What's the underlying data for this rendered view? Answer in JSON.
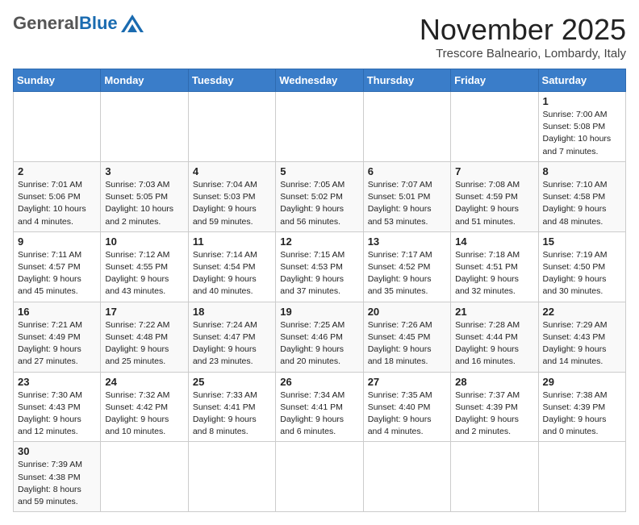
{
  "header": {
    "logo_general": "General",
    "logo_blue": "Blue",
    "month_title": "November 2025",
    "location": "Trescore Balneario, Lombardy, Italy"
  },
  "days_of_week": [
    "Sunday",
    "Monday",
    "Tuesday",
    "Wednesday",
    "Thursday",
    "Friday",
    "Saturday"
  ],
  "weeks": [
    [
      {
        "day": "",
        "info": ""
      },
      {
        "day": "",
        "info": ""
      },
      {
        "day": "",
        "info": ""
      },
      {
        "day": "",
        "info": ""
      },
      {
        "day": "",
        "info": ""
      },
      {
        "day": "",
        "info": ""
      },
      {
        "day": "1",
        "info": "Sunrise: 7:00 AM\nSunset: 5:08 PM\nDaylight: 10 hours\nand 7 minutes."
      }
    ],
    [
      {
        "day": "2",
        "info": "Sunrise: 7:01 AM\nSunset: 5:06 PM\nDaylight: 10 hours\nand 4 minutes."
      },
      {
        "day": "3",
        "info": "Sunrise: 7:03 AM\nSunset: 5:05 PM\nDaylight: 10 hours\nand 2 minutes."
      },
      {
        "day": "4",
        "info": "Sunrise: 7:04 AM\nSunset: 5:03 PM\nDaylight: 9 hours\nand 59 minutes."
      },
      {
        "day": "5",
        "info": "Sunrise: 7:05 AM\nSunset: 5:02 PM\nDaylight: 9 hours\nand 56 minutes."
      },
      {
        "day": "6",
        "info": "Sunrise: 7:07 AM\nSunset: 5:01 PM\nDaylight: 9 hours\nand 53 minutes."
      },
      {
        "day": "7",
        "info": "Sunrise: 7:08 AM\nSunset: 4:59 PM\nDaylight: 9 hours\nand 51 minutes."
      },
      {
        "day": "8",
        "info": "Sunrise: 7:10 AM\nSunset: 4:58 PM\nDaylight: 9 hours\nand 48 minutes."
      }
    ],
    [
      {
        "day": "9",
        "info": "Sunrise: 7:11 AM\nSunset: 4:57 PM\nDaylight: 9 hours\nand 45 minutes."
      },
      {
        "day": "10",
        "info": "Sunrise: 7:12 AM\nSunset: 4:55 PM\nDaylight: 9 hours\nand 43 minutes."
      },
      {
        "day": "11",
        "info": "Sunrise: 7:14 AM\nSunset: 4:54 PM\nDaylight: 9 hours\nand 40 minutes."
      },
      {
        "day": "12",
        "info": "Sunrise: 7:15 AM\nSunset: 4:53 PM\nDaylight: 9 hours\nand 37 minutes."
      },
      {
        "day": "13",
        "info": "Sunrise: 7:17 AM\nSunset: 4:52 PM\nDaylight: 9 hours\nand 35 minutes."
      },
      {
        "day": "14",
        "info": "Sunrise: 7:18 AM\nSunset: 4:51 PM\nDaylight: 9 hours\nand 32 minutes."
      },
      {
        "day": "15",
        "info": "Sunrise: 7:19 AM\nSunset: 4:50 PM\nDaylight: 9 hours\nand 30 minutes."
      }
    ],
    [
      {
        "day": "16",
        "info": "Sunrise: 7:21 AM\nSunset: 4:49 PM\nDaylight: 9 hours\nand 27 minutes."
      },
      {
        "day": "17",
        "info": "Sunrise: 7:22 AM\nSunset: 4:48 PM\nDaylight: 9 hours\nand 25 minutes."
      },
      {
        "day": "18",
        "info": "Sunrise: 7:24 AM\nSunset: 4:47 PM\nDaylight: 9 hours\nand 23 minutes."
      },
      {
        "day": "19",
        "info": "Sunrise: 7:25 AM\nSunset: 4:46 PM\nDaylight: 9 hours\nand 20 minutes."
      },
      {
        "day": "20",
        "info": "Sunrise: 7:26 AM\nSunset: 4:45 PM\nDaylight: 9 hours\nand 18 minutes."
      },
      {
        "day": "21",
        "info": "Sunrise: 7:28 AM\nSunset: 4:44 PM\nDaylight: 9 hours\nand 16 minutes."
      },
      {
        "day": "22",
        "info": "Sunrise: 7:29 AM\nSunset: 4:43 PM\nDaylight: 9 hours\nand 14 minutes."
      }
    ],
    [
      {
        "day": "23",
        "info": "Sunrise: 7:30 AM\nSunset: 4:43 PM\nDaylight: 9 hours\nand 12 minutes."
      },
      {
        "day": "24",
        "info": "Sunrise: 7:32 AM\nSunset: 4:42 PM\nDaylight: 9 hours\nand 10 minutes."
      },
      {
        "day": "25",
        "info": "Sunrise: 7:33 AM\nSunset: 4:41 PM\nDaylight: 9 hours\nand 8 minutes."
      },
      {
        "day": "26",
        "info": "Sunrise: 7:34 AM\nSunset: 4:41 PM\nDaylight: 9 hours\nand 6 minutes."
      },
      {
        "day": "27",
        "info": "Sunrise: 7:35 AM\nSunset: 4:40 PM\nDaylight: 9 hours\nand 4 minutes."
      },
      {
        "day": "28",
        "info": "Sunrise: 7:37 AM\nSunset: 4:39 PM\nDaylight: 9 hours\nand 2 minutes."
      },
      {
        "day": "29",
        "info": "Sunrise: 7:38 AM\nSunset: 4:39 PM\nDaylight: 9 hours\nand 0 minutes."
      }
    ],
    [
      {
        "day": "30",
        "info": "Sunrise: 7:39 AM\nSunset: 4:38 PM\nDaylight: 8 hours\nand 59 minutes."
      },
      {
        "day": "",
        "info": ""
      },
      {
        "day": "",
        "info": ""
      },
      {
        "day": "",
        "info": ""
      },
      {
        "day": "",
        "info": ""
      },
      {
        "day": "",
        "info": ""
      },
      {
        "day": "",
        "info": ""
      }
    ]
  ]
}
